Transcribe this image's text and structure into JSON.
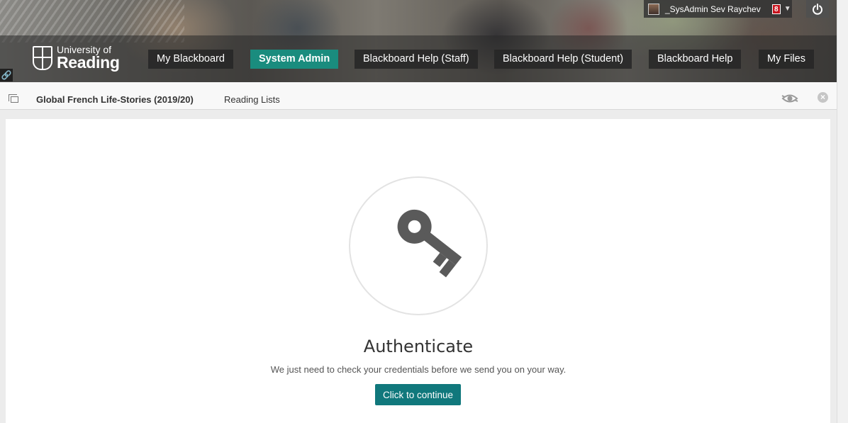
{
  "header": {
    "logo": {
      "line1": "University of",
      "line2": "Reading"
    },
    "nav_tabs": [
      {
        "label": "My Blackboard",
        "active": false
      },
      {
        "label": "System Admin",
        "active": true
      },
      {
        "label": "Blackboard Help (Staff)",
        "active": false
      },
      {
        "label": "Blackboard Help (Student)",
        "active": false
      },
      {
        "label": "Blackboard Help",
        "active": false
      },
      {
        "label": "My Files",
        "active": false
      }
    ],
    "user": {
      "name": "_SysAdmin Sev Raychev",
      "notification_count": "8"
    },
    "active_tab_color": "#1a8c7e"
  },
  "breadcrumb": {
    "course": "Global French Life-Stories (2019/20)",
    "current": "Reading Lists"
  },
  "content": {
    "title": "Authenticate",
    "message": "We just need to check your credentials before we send you on your way.",
    "button_label": "Click to continue",
    "button_color": "#10787c",
    "icon": "key-icon"
  }
}
